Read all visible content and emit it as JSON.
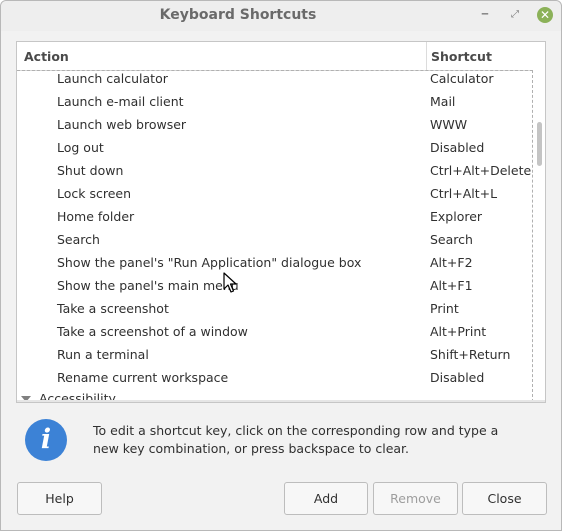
{
  "window": {
    "title": "Keyboard Shortcuts",
    "minimize_glyph": "‒",
    "maximize_glyph": "⤢",
    "close_glyph": "✕"
  },
  "table": {
    "headers": {
      "action": "Action",
      "shortcut": "Shortcut"
    },
    "rows": [
      {
        "action": "Launch calculator",
        "shortcut": "Calculator"
      },
      {
        "action": "Launch e-mail client",
        "shortcut": "Mail"
      },
      {
        "action": "Launch web browser",
        "shortcut": "WWW"
      },
      {
        "action": "Log out",
        "shortcut": "Disabled"
      },
      {
        "action": "Shut down",
        "shortcut": "Ctrl+Alt+Delete"
      },
      {
        "action": "Lock screen",
        "shortcut": "Ctrl+Alt+L"
      },
      {
        "action": "Home folder",
        "shortcut": "Explorer"
      },
      {
        "action": "Search",
        "shortcut": "Search"
      },
      {
        "action": "Show the panel's \"Run Application\" dialogue box",
        "shortcut": "Alt+F2"
      },
      {
        "action": "Show the panel's main menu",
        "shortcut": "Alt+F1"
      },
      {
        "action": "Take a screenshot",
        "shortcut": "Print"
      },
      {
        "action": "Take a screenshot of a window",
        "shortcut": "Alt+Print"
      },
      {
        "action": "Run a terminal",
        "shortcut": "Shift+Return"
      },
      {
        "action": "Rename current workspace",
        "shortcut": "Disabled"
      }
    ],
    "group": {
      "label": "Accessibility"
    }
  },
  "info": {
    "icon_glyph": "i",
    "text": "To edit a shortcut key, click on the corresponding row and type a new key combination, or press backspace to clear."
  },
  "buttons": {
    "help": "Help",
    "add": "Add",
    "remove": "Remove",
    "close": "Close"
  },
  "colors": {
    "info_icon": "#3c82d6",
    "close_button": "#8bb158",
    "disabled_text": "#9e9e9e"
  }
}
